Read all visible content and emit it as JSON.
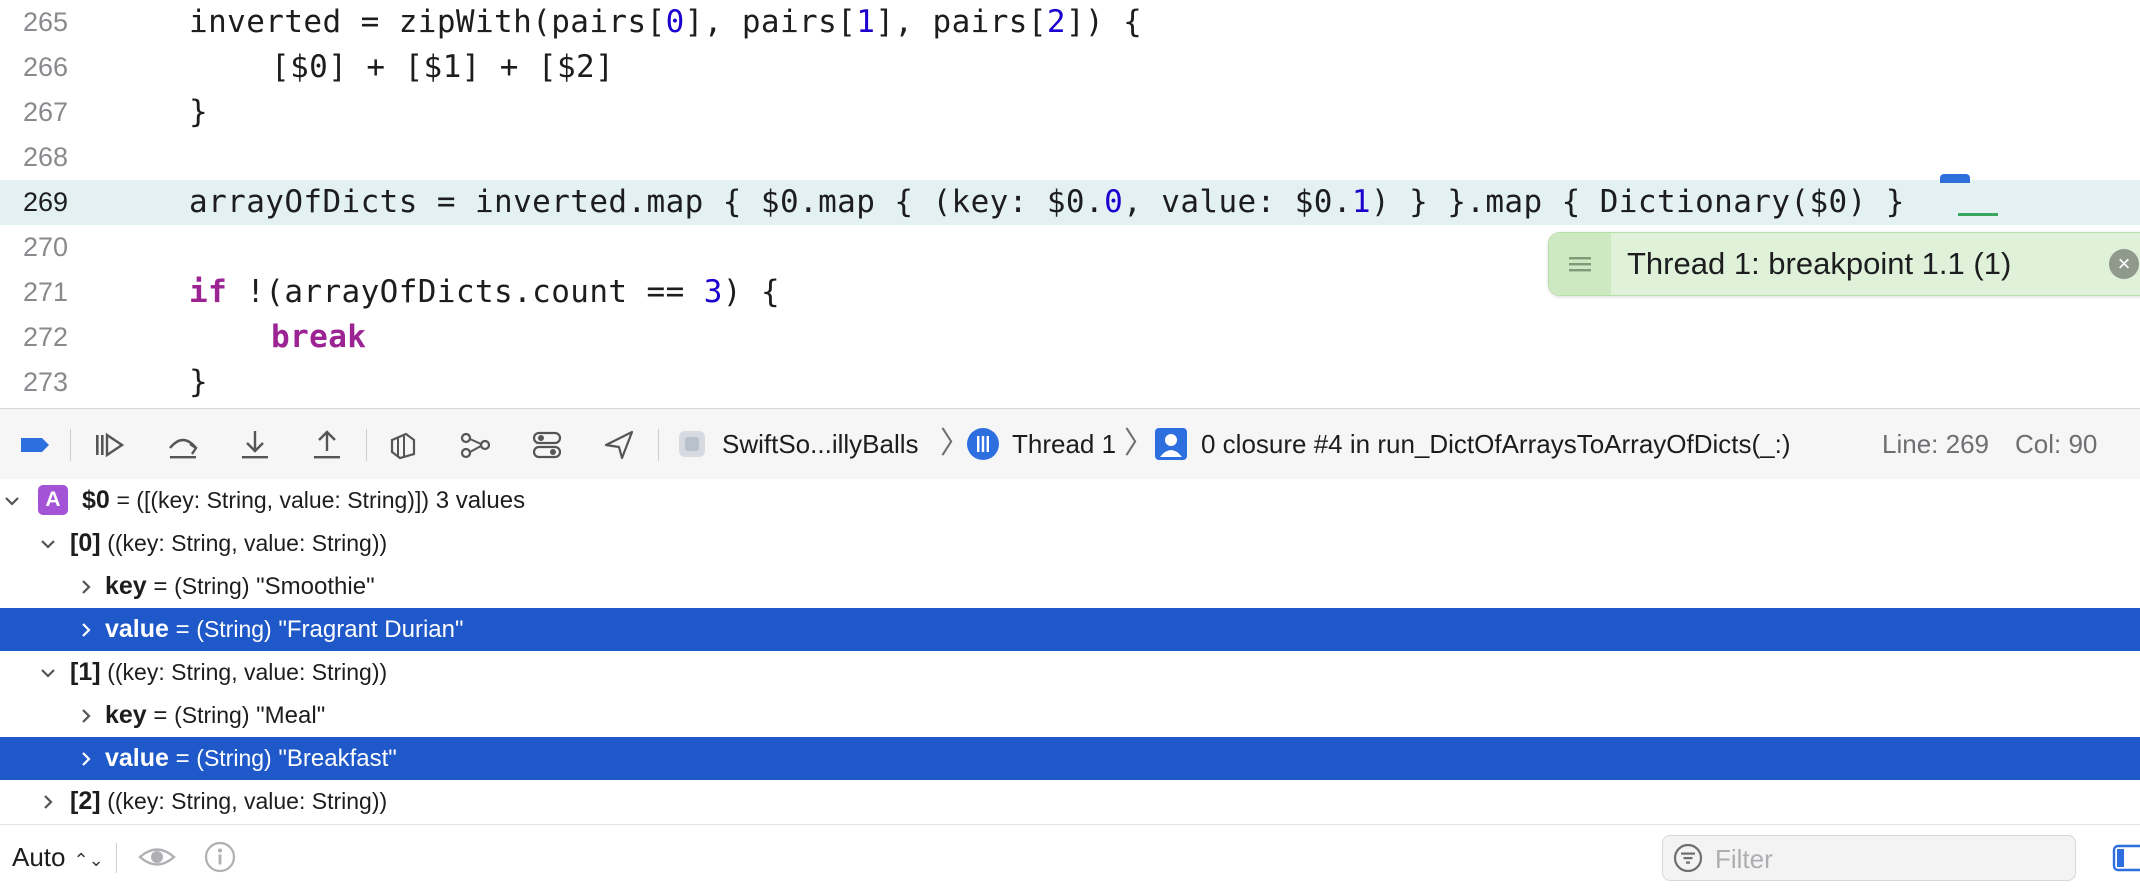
{
  "editor": {
    "lines": [
      {
        "number": "265",
        "text": "inverted = zipWith(pairs[0], pairs[1], pairs[2]) {"
      },
      {
        "number": "266",
        "text": "[$0] + [$1] + [$2]"
      },
      {
        "number": "267",
        "text": "}"
      },
      {
        "number": "268",
        "text": ""
      },
      {
        "number": "269",
        "text": "arrayOfDicts = inverted.map { $0.map { (key: $0.0, value: $0.1) } }.map { Dictionary($0) }"
      },
      {
        "number": "270",
        "text": ""
      },
      {
        "number": "271",
        "text": "if !(arrayOfDicts.count == 3) {"
      },
      {
        "number": "272",
        "text": "break"
      },
      {
        "number": "273",
        "text": "}"
      }
    ],
    "current_line": "269",
    "breakpoint_banner": "Thread 1: breakpoint 1.1 (1)"
  },
  "debug_bar": {
    "target": "SwiftSo...illyBalls",
    "thread": "Thread 1",
    "frame": "0 closure #4 in run_DictOfArraysToArrayOfDicts(_:)",
    "line": "Line: 269",
    "col": "Col: 90",
    "icons": [
      "breakpoints-toggle-icon",
      "continue-icon",
      "step-over-icon",
      "step-into-icon",
      "step-out-icon",
      "view-hierarchy-icon",
      "memory-graph-icon",
      "environment-overrides-icon",
      "location-icon"
    ]
  },
  "variables": {
    "root": {
      "badge": "A",
      "name": "$0",
      "type": "= ([(key: String, value: String)])",
      "summary": "3 values"
    },
    "items": [
      {
        "name": "[0]",
        "type": "((key: String, value: String))",
        "children": [
          {
            "name": "key",
            "eq": "=",
            "type": "(String)",
            "value": "\"Smoothie\""
          },
          {
            "name": "value",
            "eq": "=",
            "type": "(String)",
            "value": "\"Fragrant Durian\""
          }
        ]
      },
      {
        "name": "[1]",
        "type": "((key: String, value: String))",
        "children": [
          {
            "name": "key",
            "eq": "=",
            "type": "(String)",
            "value": "\"Meal\""
          },
          {
            "name": "value",
            "eq": "=",
            "type": "(String)",
            "value": "\"Breakfast\""
          }
        ]
      },
      {
        "name": "[2]",
        "type": "((key: String, value: String))"
      }
    ]
  },
  "bottom_bar": {
    "scope": "Auto",
    "filter_placeholder": "Filter"
  },
  "colors": {
    "selection": "#1f58c9",
    "current_line": "#e4f1f2",
    "keyword": "#9b2393",
    "number": "#1c00cf",
    "breakpoint_banner": "#dff1d8"
  }
}
